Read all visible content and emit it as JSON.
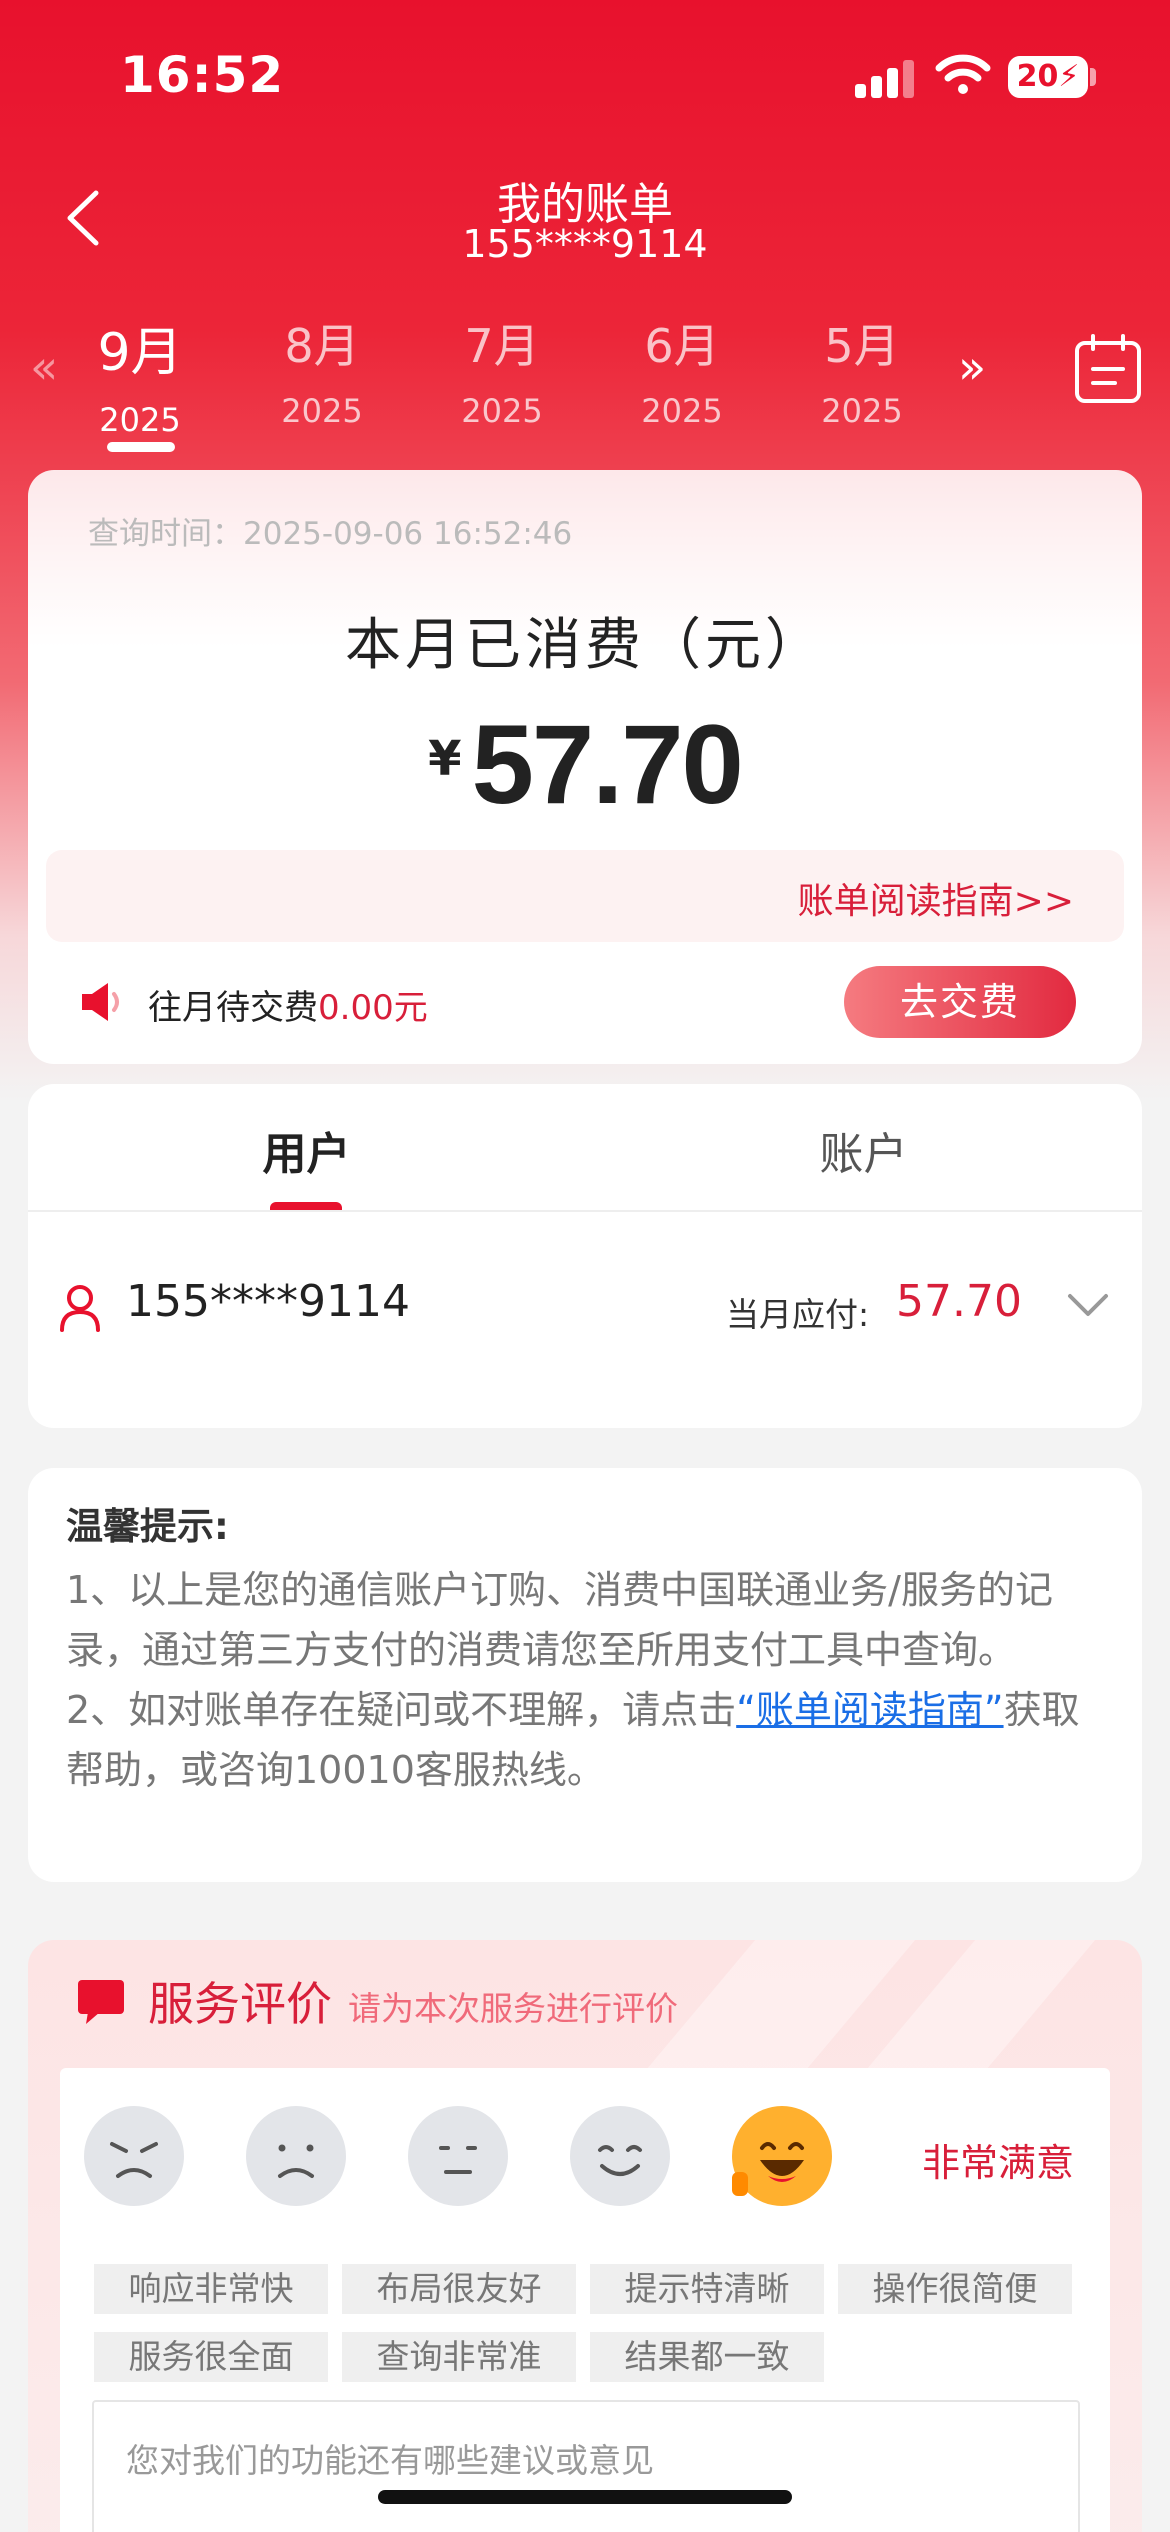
{
  "status_bar": {
    "time": "16:52",
    "battery": "20"
  },
  "header": {
    "title": "我的账单",
    "phone": "155****9114"
  },
  "months": [
    {
      "month": "9月",
      "year": "2025",
      "active": true
    },
    {
      "month": "8月",
      "year": "2025",
      "active": false
    },
    {
      "month": "7月",
      "year": "2025",
      "active": false
    },
    {
      "month": "6月",
      "year": "2025",
      "active": false
    },
    {
      "month": "5月",
      "year": "2025",
      "active": false
    }
  ],
  "summary": {
    "query_time": "查询时间：2025-09-06 16:52:46",
    "label": "本月已消费（元）",
    "currency": "¥",
    "amount": "57.70",
    "guide_link": "账单阅读指南>>",
    "overdue_prefix": "往月待交费",
    "overdue_value": "0.00元",
    "pay_button": "去交费"
  },
  "tabs": {
    "user": "用户",
    "account": "账户"
  },
  "user_row": {
    "phone": "155****9114",
    "due_label": "当月应付:",
    "due_value": "57.70"
  },
  "tips": {
    "title": "温馨提示:",
    "line1": "1、以上是您的通信账户订购、消费中国联通业务/服务的记录，通过第三方支付的消费请您至所用支付工具中查询。",
    "line2_before": "2、如对账单存在疑问或不理解，请点击",
    "line2_link": "“账单阅读指南”",
    "line2_after": "获取帮助，或咨询10010客服热线。"
  },
  "rating": {
    "title": "服务评价",
    "subtitle": "请为本次服务进行评价",
    "selected_label": "非常满意",
    "faces": [
      "angry",
      "sad",
      "neutral",
      "smile",
      "very-happy"
    ],
    "selected_index": 4,
    "tags": [
      "响应非常快",
      "布局很友好",
      "提示特清晰",
      "操作很简便",
      "服务很全面",
      "查询非常准",
      "结果都一致"
    ],
    "input_placeholder": "您对我们的功能还有哪些建议或意见"
  },
  "colors": {
    "brand_red": "#e8112d",
    "accent_red": "#d81f3a",
    "link_blue": "#1a6ee6"
  }
}
